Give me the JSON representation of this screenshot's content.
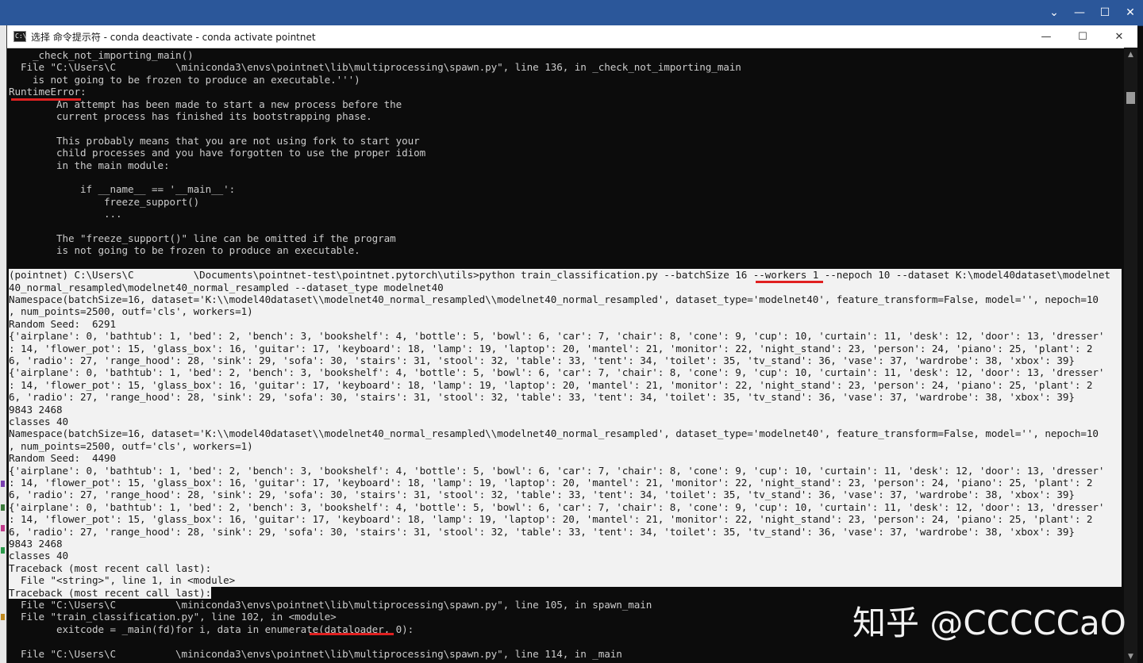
{
  "window": {
    "title": "选择 命令提示符 - conda  deactivate - conda  activate pointnet",
    "icon_text": "C:\\",
    "controls": {
      "minimize": "—",
      "maximize": "☐",
      "close": "✕"
    }
  },
  "outer_window": {
    "controls": {
      "collapse": "⌄",
      "minimize": "—",
      "maximize": "☐",
      "close": "✕"
    }
  },
  "scrollbar": {
    "up": "▲",
    "down": "▼"
  },
  "terminal": {
    "lines": [
      "    _check_not_importing_main()",
      "  File \"C:\\Users\\C          \\miniconda3\\envs\\pointnet\\lib\\multiprocessing\\spawn.py\", line 136, in _check_not_importing_main",
      "    is not going to be frozen to produce an executable.''')",
      "RuntimeError:",
      "        An attempt has been made to start a new process before the",
      "        current process has finished its bootstrapping phase.",
      "",
      "        This probably means that you are not using fork to start your",
      "        child processes and you have forgotten to use the proper idiom",
      "        in the main module:",
      "",
      "            if __name__ == '__main__':",
      "                freeze_support()",
      "                ...",
      "",
      "        The \"freeze_support()\" line can be omitted if the program",
      "        is not going to be frozen to produce an executable.",
      "",
      "(pointnet) C:\\Users\\C          \\Documents\\pointnet-test\\pointnet.pytorch\\utils>python train_classification.py --batchSize 16 --workers 1 --nepoch 10 --dataset K:\\model40dataset\\modelnet",
      "40_normal_resampled\\modelnet40_normal_resampled --dataset_type modelnet40",
      "Namespace(batchSize=16, dataset='K:\\\\model40dataset\\\\modelnet40_normal_resampled\\\\modelnet40_normal_resampled', dataset_type='modelnet40', feature_transform=False, model='', nepoch=10",
      ", num_points=2500, outf='cls', workers=1)",
      "Random Seed:  6291",
      "{'airplane': 0, 'bathtub': 1, 'bed': 2, 'bench': 3, 'bookshelf': 4, 'bottle': 5, 'bowl': 6, 'car': 7, 'chair': 8, 'cone': 9, 'cup': 10, 'curtain': 11, 'desk': 12, 'door': 13, 'dresser'",
      ": 14, 'flower_pot': 15, 'glass_box': 16, 'guitar': 17, 'keyboard': 18, 'lamp': 19, 'laptop': 20, 'mantel': 21, 'monitor': 22, 'night_stand': 23, 'person': 24, 'piano': 25, 'plant': 2",
      "6, 'radio': 27, 'range_hood': 28, 'sink': 29, 'sofa': 30, 'stairs': 31, 'stool': 32, 'table': 33, 'tent': 34, 'toilet': 35, 'tv_stand': 36, 'vase': 37, 'wardrobe': 38, 'xbox': 39}",
      "{'airplane': 0, 'bathtub': 1, 'bed': 2, 'bench': 3, 'bookshelf': 4, 'bottle': 5, 'bowl': 6, 'car': 7, 'chair': 8, 'cone': 9, 'cup': 10, 'curtain': 11, 'desk': 12, 'door': 13, 'dresser'",
      ": 14, 'flower_pot': 15, 'glass_box': 16, 'guitar': 17, 'keyboard': 18, 'lamp': 19, 'laptop': 20, 'mantel': 21, 'monitor': 22, 'night_stand': 23, 'person': 24, 'piano': 25, 'plant': 2",
      "6, 'radio': 27, 'range_hood': 28, 'sink': 29, 'sofa': 30, 'stairs': 31, 'stool': 32, 'table': 33, 'tent': 34, 'toilet': 35, 'tv_stand': 36, 'vase': 37, 'wardrobe': 38, 'xbox': 39}",
      "9843 2468",
      "classes 40",
      "Namespace(batchSize=16, dataset='K:\\\\model40dataset\\\\modelnet40_normal_resampled\\\\modelnet40_normal_resampled', dataset_type='modelnet40', feature_transform=False, model='', nepoch=10",
      ", num_points=2500, outf='cls', workers=1)",
      "Random Seed:  4490",
      "{'airplane': 0, 'bathtub': 1, 'bed': 2, 'bench': 3, 'bookshelf': 4, 'bottle': 5, 'bowl': 6, 'car': 7, 'chair': 8, 'cone': 9, 'cup': 10, 'curtain': 11, 'desk': 12, 'door': 13, 'dresser'",
      ": 14, 'flower_pot': 15, 'glass_box': 16, 'guitar': 17, 'keyboard': 18, 'lamp': 19, 'laptop': 20, 'mantel': 21, 'monitor': 22, 'night_stand': 23, 'person': 24, 'piano': 25, 'plant': 2",
      "6, 'radio': 27, 'range_hood': 28, 'sink': 29, 'sofa': 30, 'stairs': 31, 'stool': 32, 'table': 33, 'tent': 34, 'toilet': 35, 'tv_stand': 36, 'vase': 37, 'wardrobe': 38, 'xbox': 39}",
      "{'airplane': 0, 'bathtub': 1, 'bed': 2, 'bench': 3, 'bookshelf': 4, 'bottle': 5, 'bowl': 6, 'car': 7, 'chair': 8, 'cone': 9, 'cup': 10, 'curtain': 11, 'desk': 12, 'door': 13, 'dresser'",
      ": 14, 'flower_pot': 15, 'glass_box': 16, 'guitar': 17, 'keyboard': 18, 'lamp': 19, 'laptop': 20, 'mantel': 21, 'monitor': 22, 'night_stand': 23, 'person': 24, 'piano': 25, 'plant': 2",
      "6, 'radio': 27, 'range_hood': 28, 'sink': 29, 'sofa': 30, 'stairs': 31, 'stool': 32, 'table': 33, 'tent': 34, 'toilet': 35, 'tv_stand': 36, 'vase': 37, 'wardrobe': 38, 'xbox': 39}",
      "9843 2468",
      "classes 40",
      "Traceback (most recent call last):",
      "  File \"<string>\", line 1, in <module>",
      "Traceback (most recent call last):",
      "  File \"C:\\Users\\C          \\miniconda3\\envs\\pointnet\\lib\\multiprocessing\\spawn.py\", line 105, in spawn_main",
      "  File \"train_classification.py\", line 102, in <module>",
      "        exitcode = _main(fd)for i, data in enumerate(dataloader, 0):",
      "",
      "  File \"C:\\Users\\C          \\miniconda3\\envs\\pointnet\\lib\\multiprocessing\\spawn.py\", line 114, in _main"
    ],
    "selected_from": 18,
    "selected_to": 44
  },
  "watermark": "知乎 @CCCCCaO",
  "colors": {
    "terminal_bg": "#0c0c0c",
    "terminal_fg": "#cccccc",
    "selection_bg": "#f2f2f2",
    "annotation": "#e02020",
    "outer_titlebar": "#2b579a"
  }
}
